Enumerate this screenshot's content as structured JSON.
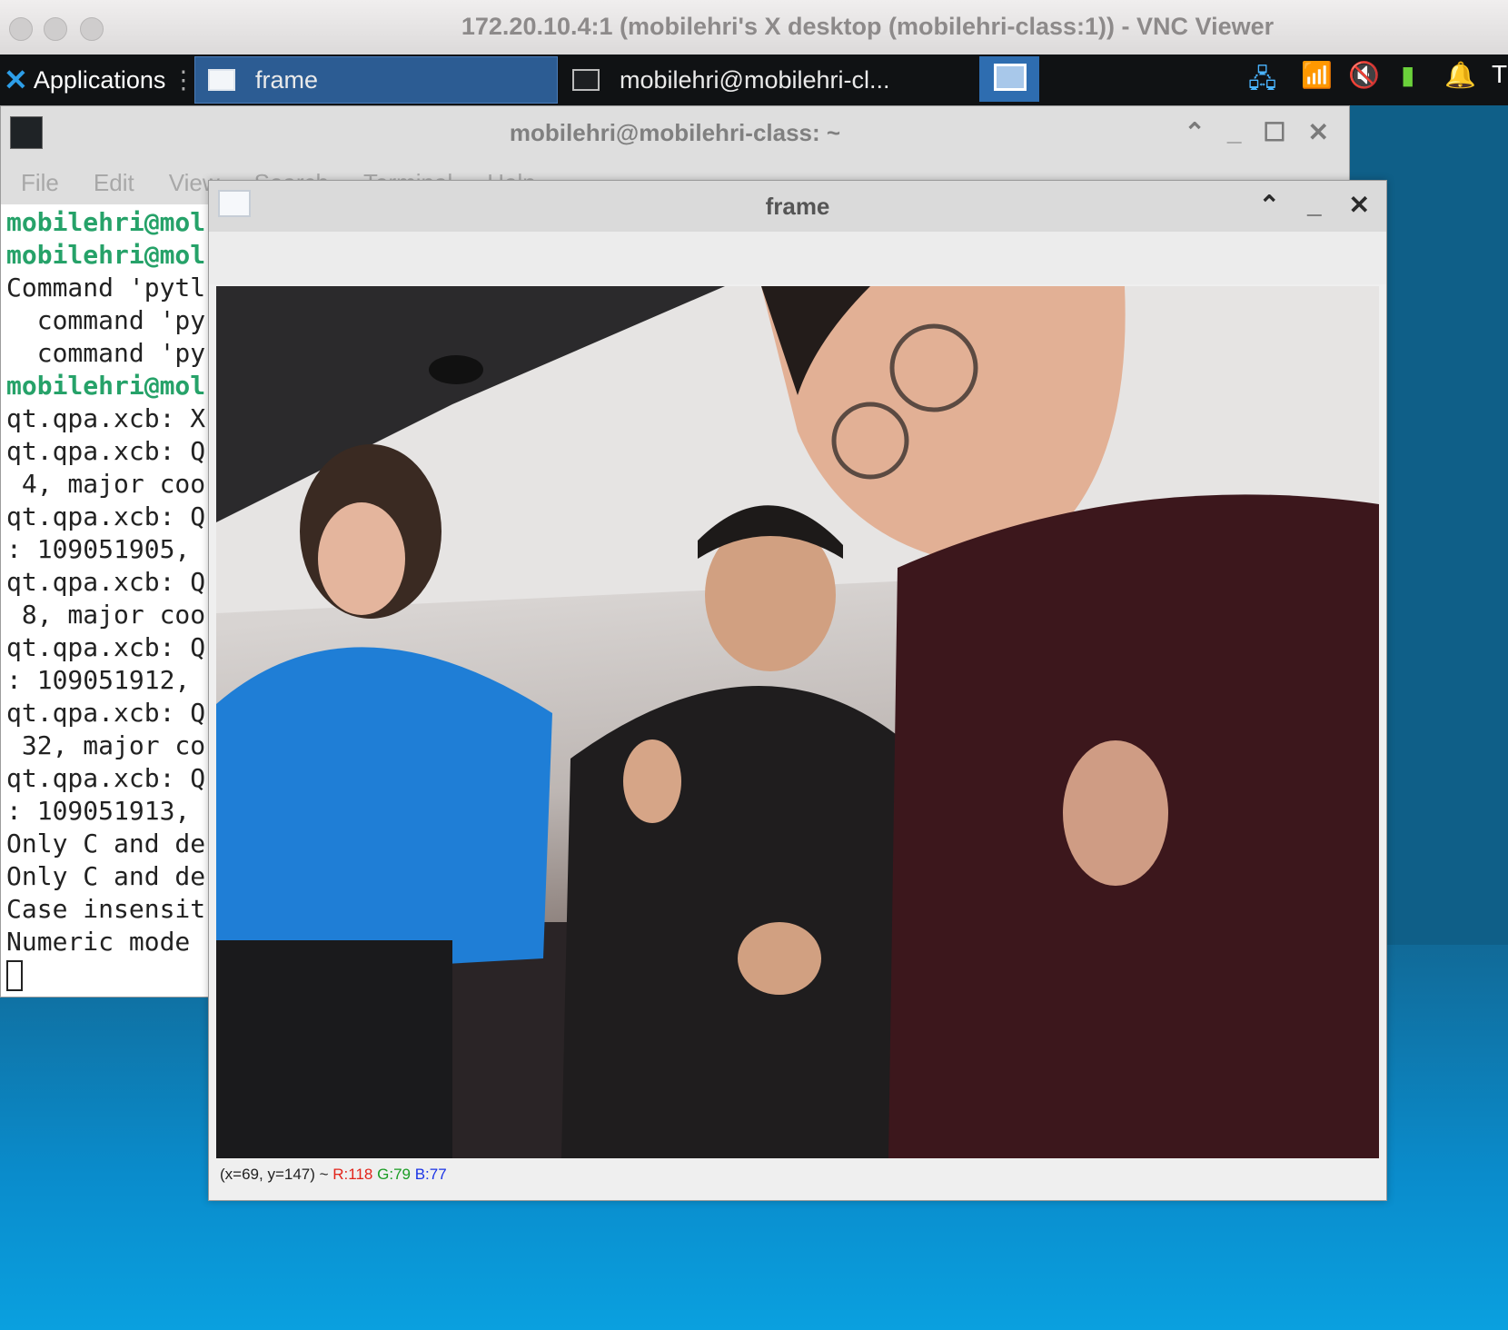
{
  "vnc": {
    "title": "172.20.10.4:1 (mobilehri's X desktop (mobilehri-class:1)) - VNC Viewer"
  },
  "panel": {
    "applications": "Applications",
    "tasks": [
      {
        "label": "frame"
      },
      {
        "label": "mobilehri@mobilehri-cl..."
      }
    ],
    "tray_partial": "T"
  },
  "terminal": {
    "title": "mobilehri@mobilehri-class: ~",
    "menu": [
      "File",
      "Edit",
      "View",
      "Search",
      "Terminal",
      "Help"
    ],
    "lines": [
      {
        "text": "mobilehri@mol",
        "prompt": true
      },
      {
        "text": "mobilehri@mol",
        "prompt": true
      },
      {
        "text": "Command 'pytl",
        "prompt": false
      },
      {
        "text": "  command 'py",
        "prompt": false
      },
      {
        "text": "  command 'py",
        "prompt": false
      },
      {
        "text": "mobilehri@mol",
        "prompt": true
      },
      {
        "text": "qt.qpa.xcb: X",
        "prompt": false
      },
      {
        "text": "qt.qpa.xcb: Q",
        "prompt": false
      },
      {
        "text": " 4, major coo",
        "prompt": false
      },
      {
        "text": "qt.qpa.xcb: Q",
        "prompt": false
      },
      {
        "text": ": 109051905,",
        "prompt": false
      },
      {
        "text": "qt.qpa.xcb: Q",
        "prompt": false
      },
      {
        "text": " 8, major coo",
        "prompt": false
      },
      {
        "text": "qt.qpa.xcb: Q",
        "prompt": false
      },
      {
        "text": ": 109051912,",
        "prompt": false
      },
      {
        "text": "qt.qpa.xcb: Q",
        "prompt": false
      },
      {
        "text": " 32, major co",
        "prompt": false
      },
      {
        "text": "qt.qpa.xcb: Q",
        "prompt": false
      },
      {
        "text": ": 109051913,",
        "prompt": false
      },
      {
        "text": "Only C and de",
        "prompt": false
      },
      {
        "text": "Only C and de",
        "prompt": false
      },
      {
        "text": "Case insensit",
        "prompt": false
      },
      {
        "text": "Numeric mode",
        "prompt": false
      }
    ]
  },
  "frame": {
    "title": "frame",
    "status": {
      "coords": "(x=69, y=147) ~ ",
      "r": "R:118",
      "g": "G:79",
      "b": "B:77"
    }
  },
  "colors": {
    "prompt": "#26a269",
    "panel": "#101214",
    "active_task": "#2c5c93",
    "desktop": "#0aa0df"
  },
  "icons": [
    "xfce-logo-icon",
    "window-icon",
    "terminal-icon",
    "show-desktop-icon",
    "network-icon",
    "wifi-icon",
    "volume-muted-icon",
    "battery-icon",
    "bell-icon",
    "maximize-icon",
    "minimize-icon",
    "close-icon",
    "shade-icon"
  ]
}
